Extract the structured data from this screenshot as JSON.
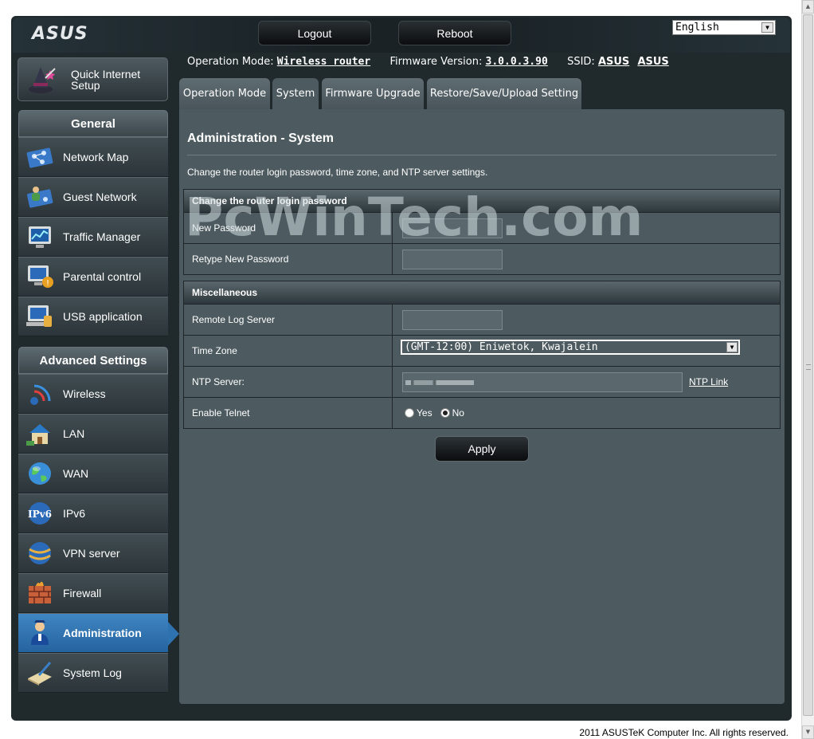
{
  "header": {
    "logo": "ASUS",
    "logout_label": "Logout",
    "reboot_label": "Reboot",
    "language": "English"
  },
  "infobar": {
    "operation_mode_label": "Operation Mode:",
    "operation_mode_value": "Wireless router",
    "firmware_label": "Firmware Version:",
    "firmware_value": "3.0.0.3.90",
    "ssid_label": "SSID:",
    "ssid_values": [
      "ASUS",
      "ASUS"
    ]
  },
  "sidebar": {
    "quick_setup": "Quick Internet Setup",
    "general_title": "General",
    "general_items": [
      {
        "label": "Network Map",
        "icon": "network-map-icon"
      },
      {
        "label": "Guest Network",
        "icon": "guest-network-icon"
      },
      {
        "label": "Traffic Manager",
        "icon": "traffic-manager-icon"
      },
      {
        "label": "Parental control",
        "icon": "parental-control-icon"
      },
      {
        "label": "USB application",
        "icon": "usb-application-icon"
      }
    ],
    "advanced_title": "Advanced Settings",
    "advanced_items": [
      {
        "label": "Wireless",
        "icon": "wireless-icon"
      },
      {
        "label": "LAN",
        "icon": "lan-icon"
      },
      {
        "label": "WAN",
        "icon": "wan-globe-icon"
      },
      {
        "label": "IPv6",
        "icon": "ipv6-icon"
      },
      {
        "label": "VPN server",
        "icon": "vpn-server-icon"
      },
      {
        "label": "Firewall",
        "icon": "firewall-icon"
      },
      {
        "label": "Administration",
        "icon": "administration-icon",
        "active": true
      },
      {
        "label": "System Log",
        "icon": "system-log-icon"
      }
    ]
  },
  "tabs": [
    {
      "label": "Operation Mode"
    },
    {
      "label": "System",
      "active": true
    },
    {
      "label": "Firmware Upgrade"
    },
    {
      "label": "Restore/Save/Upload Setting"
    }
  ],
  "main": {
    "title": "Administration - System",
    "description": "Change the router login password, time zone, and NTP server settings.",
    "password_section": {
      "title": "Change the router login password",
      "new_password_label": "New Password",
      "retype_password_label": "Retype New Password"
    },
    "misc_section": {
      "title": "Miscellaneous",
      "remote_log_label": "Remote Log Server",
      "time_zone_label": "Time Zone",
      "time_zone_value": "(GMT-12:00) Eniwetok, Kwajalein",
      "ntp_label": "NTP Server:",
      "ntp_link": "NTP Link",
      "telnet_label": "Enable Telnet",
      "telnet_yes": "Yes",
      "telnet_no": "No"
    },
    "apply_label": "Apply"
  },
  "watermark": "PcWinTech.com",
  "footer": "2011 ASUSTeK Computer Inc. All rights reserved.",
  "colors": {
    "panel": "#4d5b60",
    "active_item": "#2f72b0",
    "frame": "#20292c"
  }
}
